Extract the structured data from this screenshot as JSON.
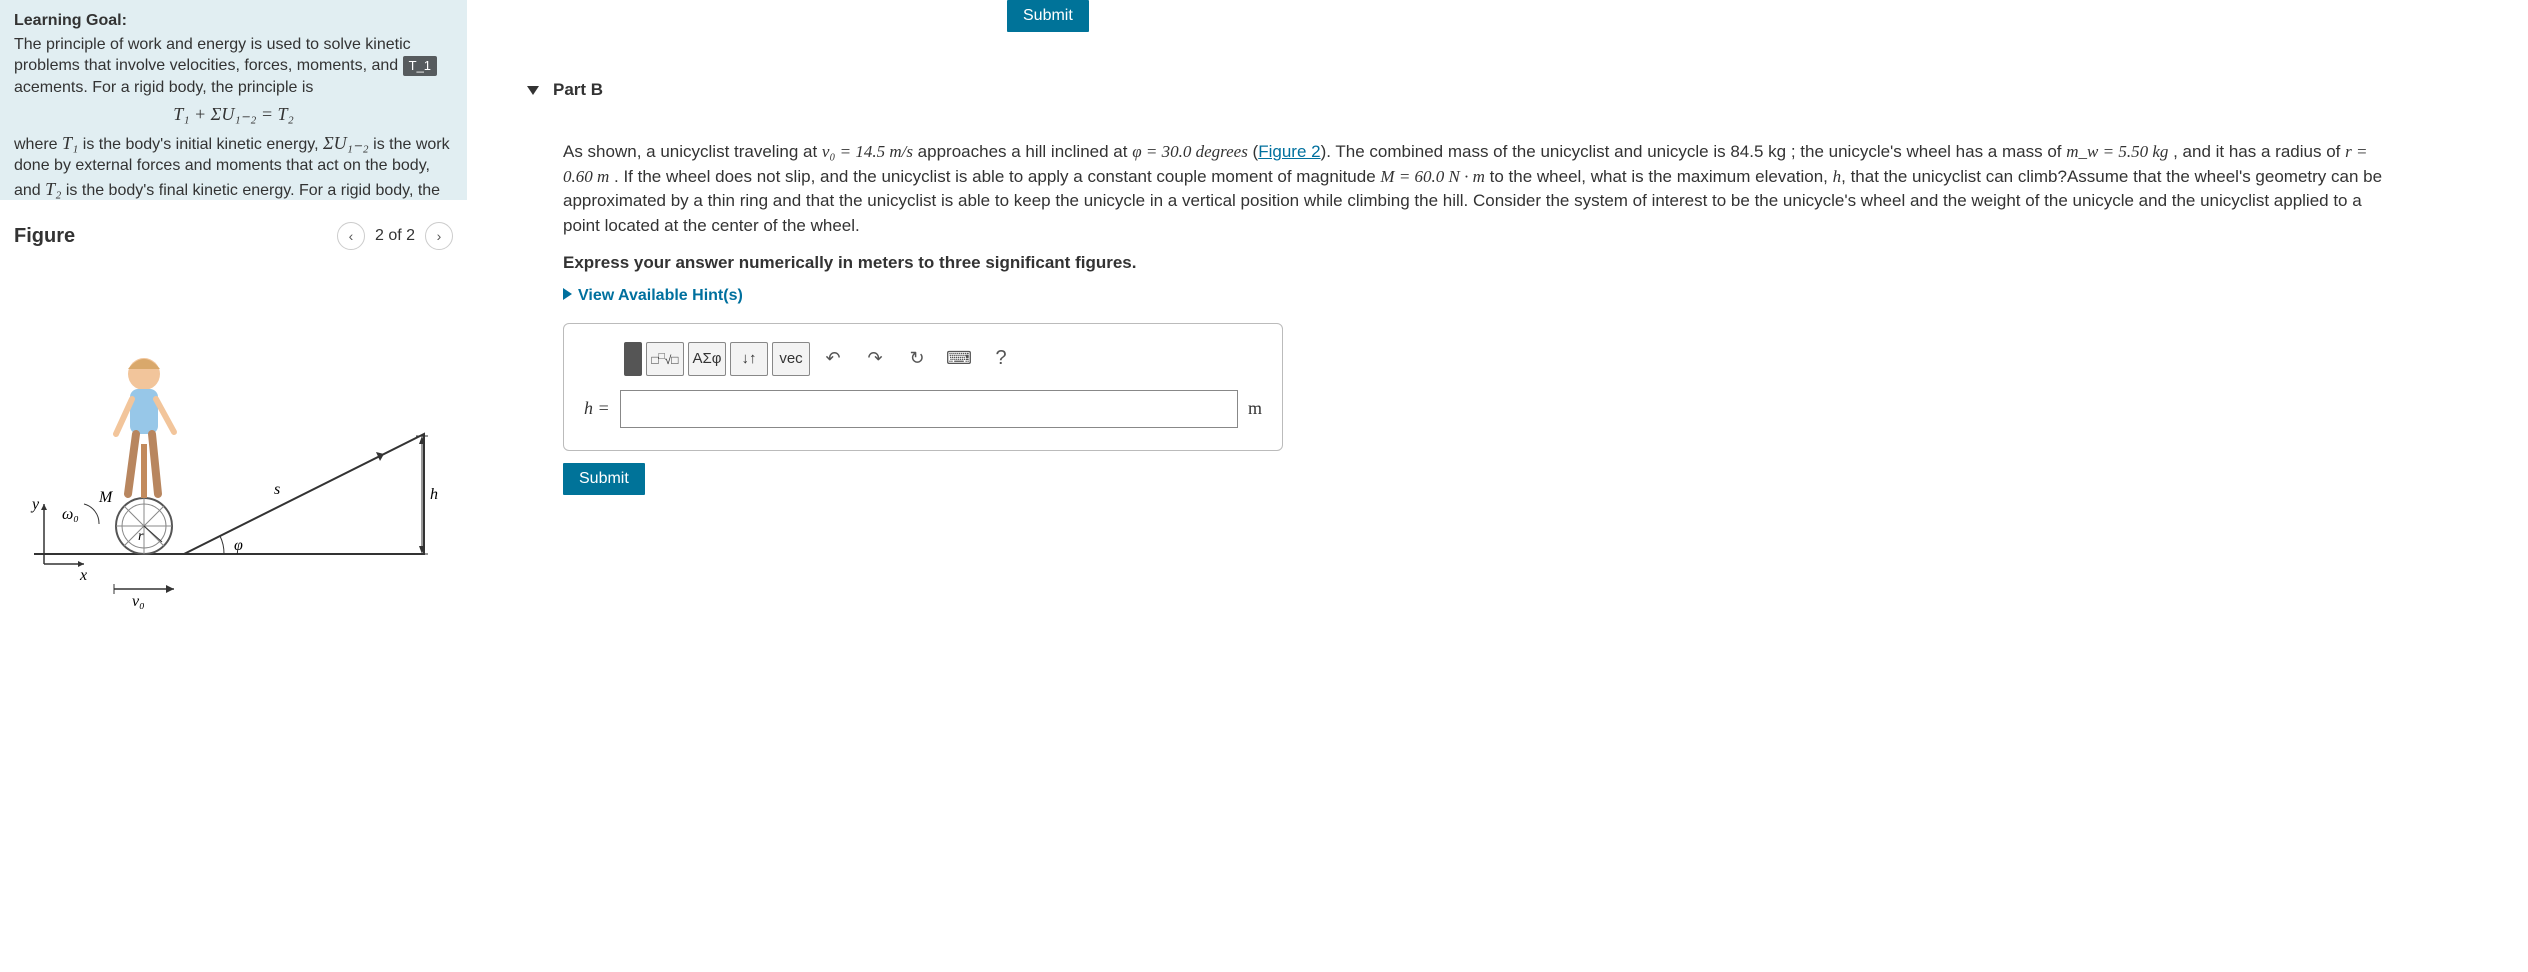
{
  "learning_goal": {
    "title": "Learning Goal:",
    "line1": "The principle of work and energy is used to solve kinetic problems that involve velocities, forces, moments, and",
    "badge": "T_1",
    "line1b": "acements. For a rigid body, the principle is",
    "equation": "T₁ + ΣU₁₋₂ = T₂",
    "line2a": "where ",
    "t1": "T₁",
    "line2b": " is the body's initial kinetic energy, ",
    "sumu": "ΣU₁₋₂",
    "line2c": " is the work done by external forces and moments that act on the body, and ",
    "t2": "T₂",
    "line2d": " is the body's final kinetic energy. For a rigid body, the kinetic energy is broken into two"
  },
  "figure": {
    "title": "Figure",
    "pager": "2 of 2",
    "labels": {
      "y": "y",
      "x": "x",
      "M": "M",
      "w0": "ω₀",
      "r": "r",
      "s": "s",
      "phi": "φ",
      "h": "h",
      "v0": "v₀"
    }
  },
  "submit": "Submit",
  "part": {
    "label": "Part B",
    "text_prefix": "As shown, a unicyclist traveling at ",
    "v0": "v₀ = 14.5 m/s",
    "text2": " approaches a hill inclined at ",
    "phi": "φ = 30.0 degrees",
    "text3": " (",
    "fig_link": "Figure 2",
    "text4": "). The combined mass of the unicyclist and unicycle is 84.5 kg ; the unicycle's wheel has a mass of ",
    "mw": "m_w = 5.50 kg",
    "text5": " , and it has a radius of ",
    "r": "r = 0.60 m",
    "text6": " . If the wheel does not slip, and the unicyclist is able to apply a constant couple moment of magnitude ",
    "M": "M = 60.0 N · m",
    "text7": " to the wheel, what is the maximum elevation, ",
    "h": "h",
    "text8": ", that the unicyclist can climb?Assume that the wheel's geometry can be approximated by a thin ring and that the unicyclist is able to keep the unicycle in a vertical position while climbing the hill. Consider the system of interest to be the unicycle's wheel and the weight of the unicycle and the unicyclist applied to a point located at the center of the wheel.",
    "instruction": "Express your answer numerically in meters to three significant figures.",
    "hints": "View Available Hint(s)",
    "answer_label": "h =",
    "unit": "m",
    "toolbar": {
      "templates": "▢√▢",
      "greek": "ΑΣφ",
      "subsup": "↓↑",
      "vec": "vec",
      "undo": "↶",
      "redo": "↷",
      "reset": "↻",
      "keyboard": "⌨",
      "help": "?"
    }
  }
}
